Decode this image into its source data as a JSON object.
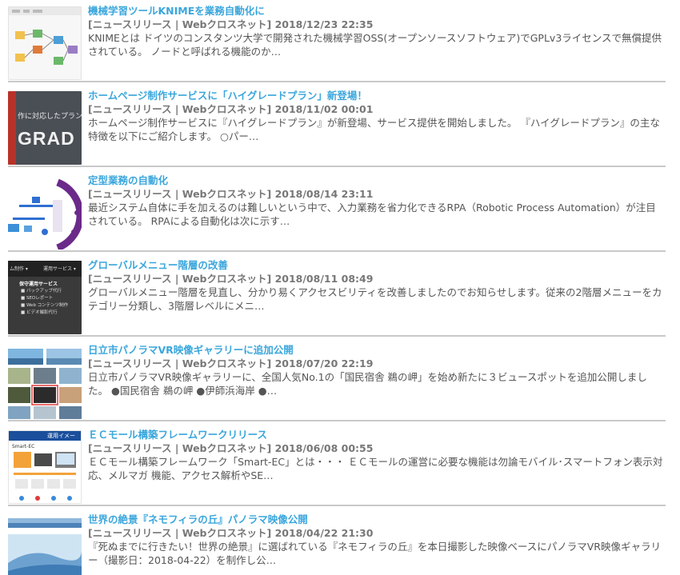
{
  "articles": [
    {
      "thumb": "knime-workflow-thumbnail",
      "title": "機械学習ツールKNIMEを業務自動化に",
      "meta": "[ニュースリリース | Webクロスネット] 2018/12/23 22:35",
      "excerpt": "KNIMEとは ドイツのコンスタンツ大学で開発された機械学習OSS(オープンソースソフトウェア)でGPLv3ライセンスで無償提供されている。 ノードと呼ばれる機能のか…"
    },
    {
      "thumb": "high-grade-plan-thumbnail",
      "thumb_text_top": "作に対応したプラン",
      "thumb_text_big": "GRAD",
      "title": "ホームページ制作サービスに「ハイグレードプラン」新登場！",
      "meta": "[ニュースリリース | Webクロスネット] 2018/11/02 00:01",
      "excerpt": "ホームページ制作サービスに『ハイグレードプラン』が新登場、サービス提供を開始しました。 『ハイグレードプラン』の主な特徴を以下にご紹介します。 ○パー…"
    },
    {
      "thumb": "rpa-automation-thumbnail",
      "title": "定型業務の自動化",
      "meta": "[ニュースリリース | Webクロスネット] 2018/08/14 23:11",
      "excerpt": "最近システム自体に手を加えるのは難しいという中で、入力業務を省力化できるRPA（Robotic Process Automation）が注目されている。 RPAによる自動化は次に示す…"
    },
    {
      "thumb": "global-menu-thumbnail",
      "thumb_menu_a": "ム制作 ▾",
      "thumb_menu_b": "運用サービス ▾",
      "thumb_menu_head": "保守運用サービス",
      "thumb_menu_items": [
        "■ バックアップ代行",
        "■ SEOレポート",
        "■ Web コンテンツ制作",
        "■ ビデオ撮影代行"
      ],
      "title": "グローバルメニュー階層の改善",
      "meta": "[ニュースリリース | Webクロスネット] 2018/08/11 08:49",
      "excerpt": "グローバルメニュー階層を見直し、分かり易くアクセスビリティを改善しましたのでお知らせします。従来の2階層メニューをカテゴリー分類し、3階層レベルにメニ…"
    },
    {
      "thumb": "hitachi-panorama-thumbnail",
      "title": "日立市パノラマVR映像ギャラリーに追加公開",
      "meta": "[ニュースリリース | Webクロスネット] 2018/07/20 22:19",
      "excerpt": "日立市パノラマVR映像ギャラリーに、全国人気No.1の「国民宿舎 鵜の岬」を始め新たに３ビュースポットを追加公開しました。 ●国民宿舎 鵜の岬 ●伊師浜海岸 ●…"
    },
    {
      "thumb": "ec-framework-thumbnail",
      "thumb_header_text": "運用イメー",
      "thumb_label": "Smart-EC",
      "title": "ＥＣモール構築フレームワークリリース",
      "meta": "[ニュースリリース | Webクロスネット] 2018/06/08 00:55",
      "excerpt": "ＥＣモール構築フレームワーク「Smart-EC」とは・・・ ＥＣモールの運営に必要な機能は勿論モバイル･スマートフォン表示対応、メルマガ 機能、アクセス解析やSE…"
    },
    {
      "thumb": "nemophila-hill-thumbnail",
      "title": "世界の絶景『ネモフィラの丘』パノラマ映像公開",
      "meta": "[ニュースリリース | Webクロスネット] 2018/04/22 21:30",
      "excerpt": "『死ぬまでに行きたい！世界の絶景』に選ばれている『ネモフィラの丘』を本日撮影した映像ベースにパノラマVR映像ギャラリー（撮影日：2018-04-22）を制作し公…"
    }
  ]
}
